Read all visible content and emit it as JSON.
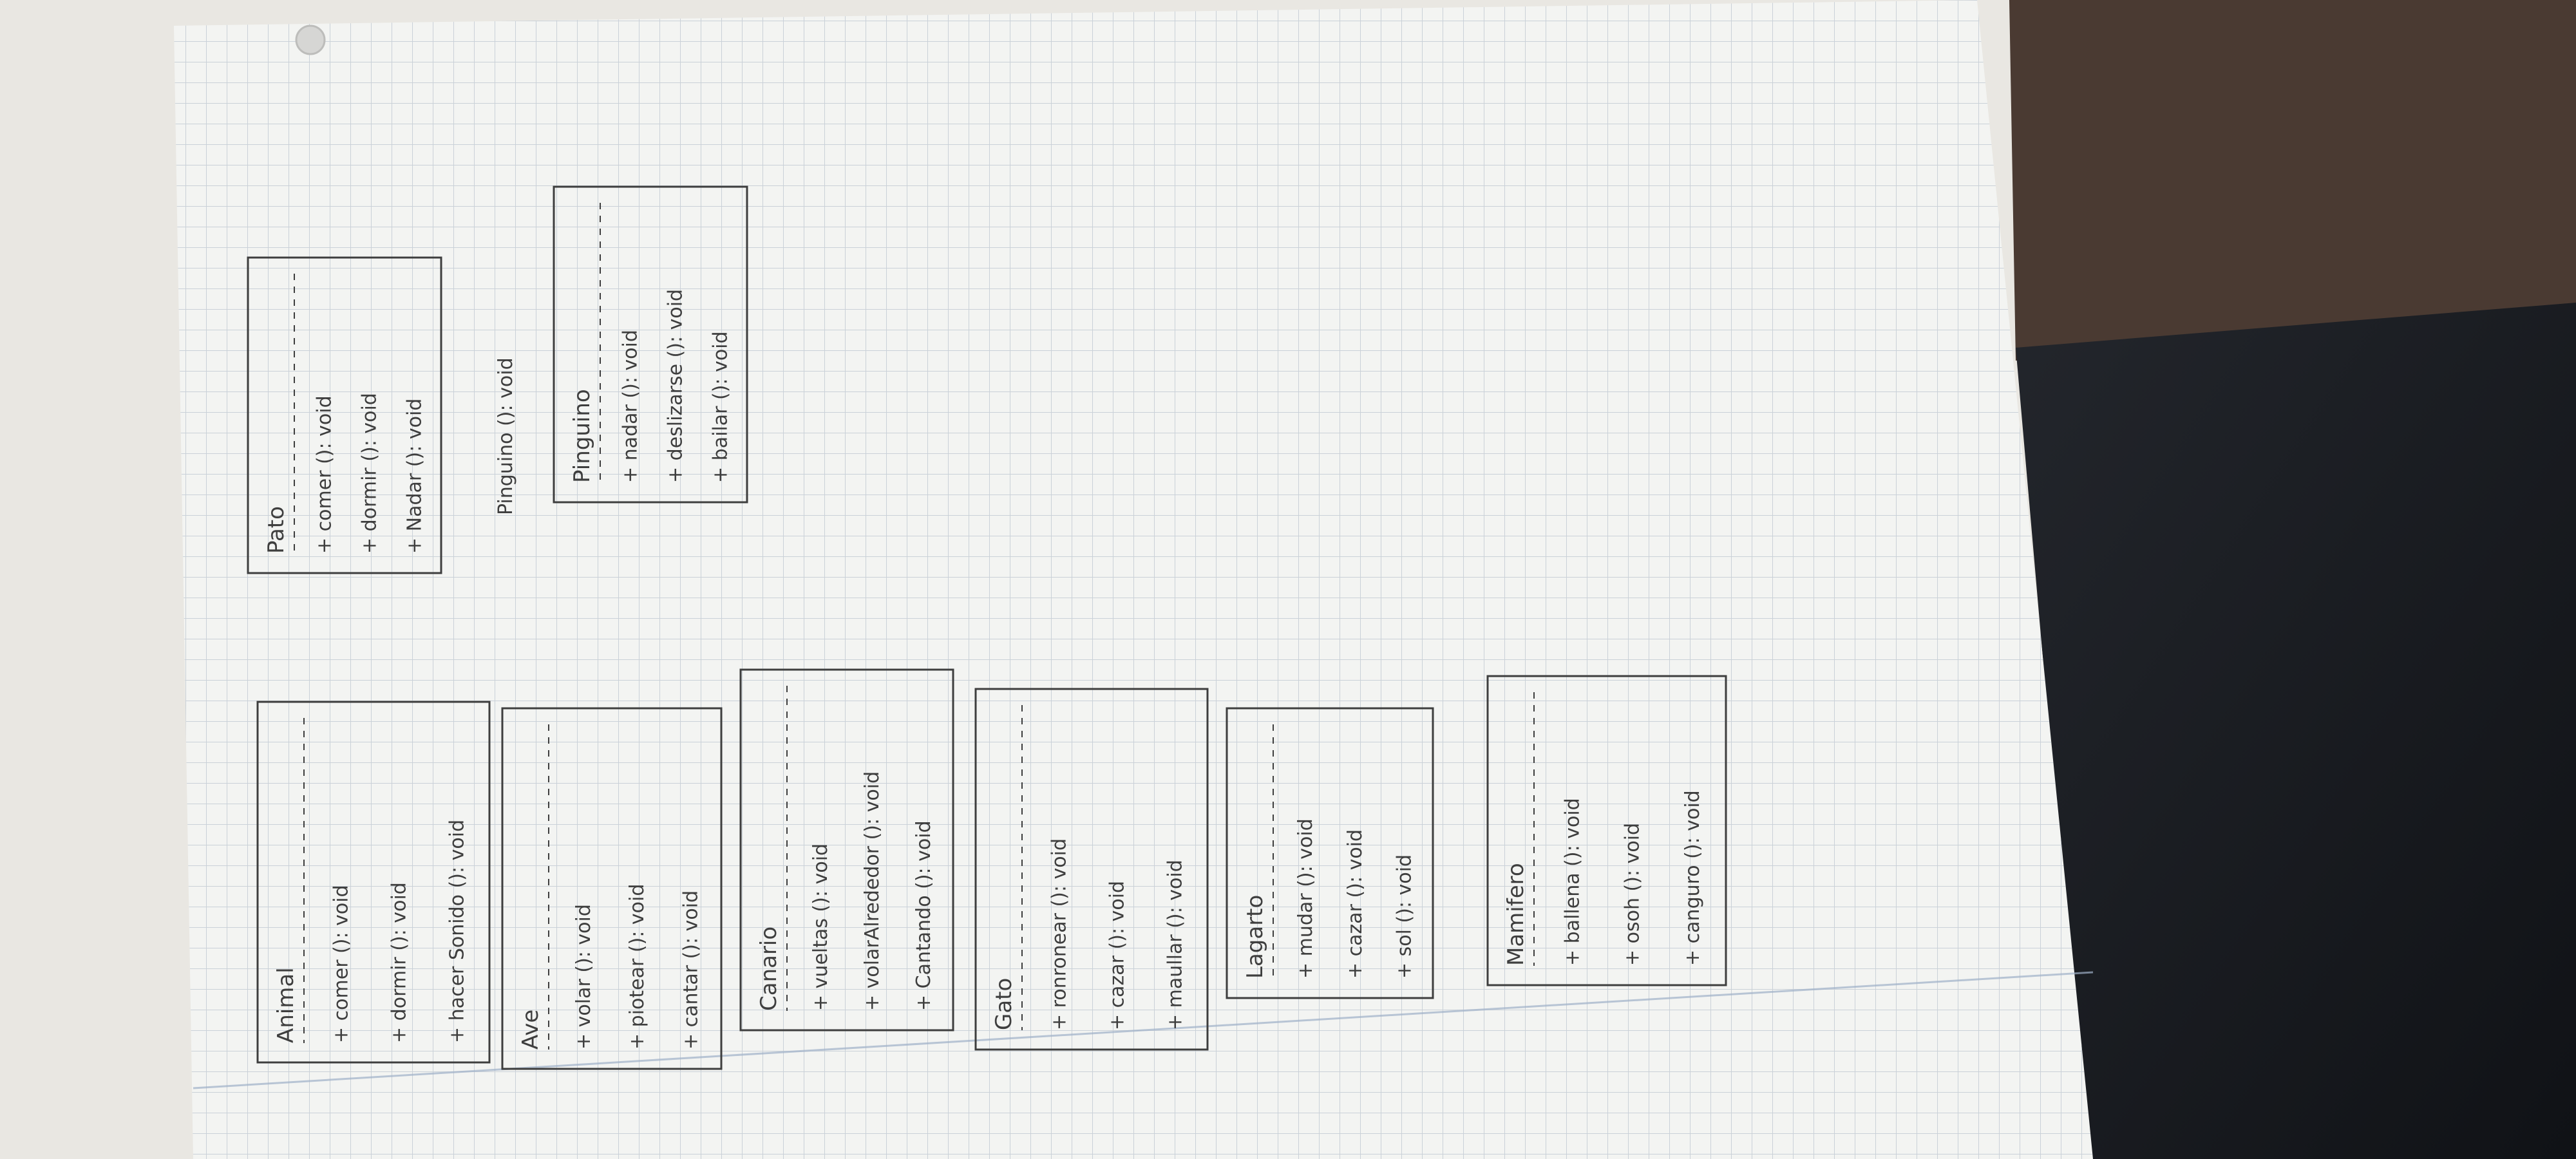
{
  "colors": {
    "background": "#e9e7e2",
    "paper": "#f3f4f2",
    "grid": "#a9b5c3",
    "pencil": "#3e3e3e",
    "dark_fabric": "#17191e",
    "wood": "#4a3a32"
  },
  "classes": [
    {
      "name": "Animal",
      "methods": [
        "+ comer (): void",
        "+ dormir (): void",
        "+ hacer Sonido (): void"
      ]
    },
    {
      "name": "Ave",
      "methods": [
        "+ volar (): void",
        "+ piotear (): void",
        "+ cantar (): void"
      ]
    },
    {
      "name": "Canario",
      "methods": [
        "+ vueltas (): void",
        "+ volarAlrededor (): void",
        "+ Cantando (): void"
      ]
    },
    {
      "name": "Gato",
      "methods": [
        "+ ronronear (): void",
        "+ cazar (): void",
        "+ maullar (): void"
      ]
    },
    {
      "name": "Lagarto",
      "methods": [
        "+ mudar (): void",
        "+ cazar (): void",
        "+ sol (): void"
      ]
    },
    {
      "name": "Mamifero",
      "methods": [
        "+ ballena (): void",
        "+ osoh (): void",
        "+ canguro (): void"
      ]
    },
    {
      "name": "Pato",
      "methods": [
        "+ comer (): void",
        "+ dormir (): void",
        "+ Nadar (): void"
      ]
    },
    {
      "name": "Pinguino",
      "methods": [
        "+ nadar (): void",
        "+ deslizarse (): void",
        "+ bailar (): void"
      ]
    }
  ],
  "loose_note": "Pinguino (): void"
}
